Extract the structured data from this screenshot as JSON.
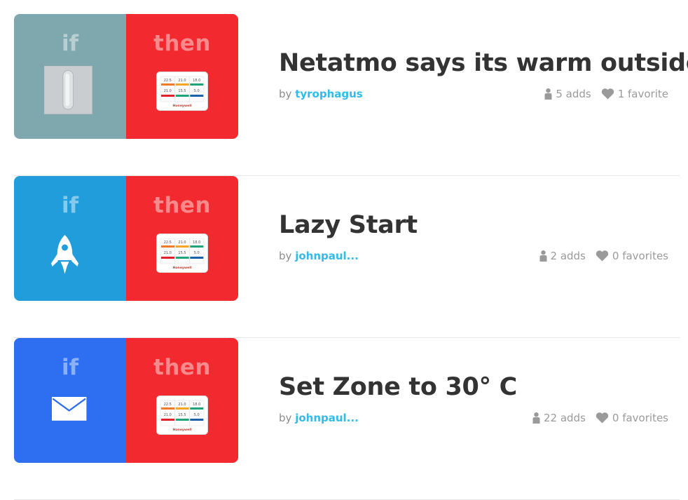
{
  "colors": {
    "then_red": "#f22a2f",
    "author_blue": "#2fbcea",
    "title_text": "#333333",
    "meta_grey": "#9a9a9a"
  },
  "recipes": [
    {
      "if_label": "if",
      "then_label": "then",
      "if_icon": "light-switch-icon",
      "if_color": "#7fa8ae",
      "then_icon": "honeywell-thermostat-icon",
      "title": "Netatmo says its warm outside",
      "by": "by",
      "author": "tyrophagus",
      "adds": "5 adds",
      "favorites": "1 favorite"
    },
    {
      "if_label": "if",
      "then_label": "then",
      "if_icon": "rocket-icon",
      "if_color": "#229ddb",
      "then_icon": "honeywell-thermostat-icon",
      "title": "Lazy Start",
      "by": "by",
      "author": "johnpaul...",
      "adds": "2 adds",
      "favorites": "0 favorites"
    },
    {
      "if_label": "if",
      "then_label": "then",
      "if_icon": "email-icon",
      "if_color": "#2e6ff2",
      "then_icon": "honeywell-thermostat-icon",
      "title": "Set Zone to 30° C",
      "by": "by",
      "author": "johnpaul...",
      "adds": "22 adds",
      "favorites": "0 favorites"
    }
  ],
  "thermostat": {
    "readings": [
      "22.5",
      "21.0",
      "18.0",
      "21.0",
      "15.5",
      "5.0"
    ],
    "brand": "Honeywell"
  }
}
